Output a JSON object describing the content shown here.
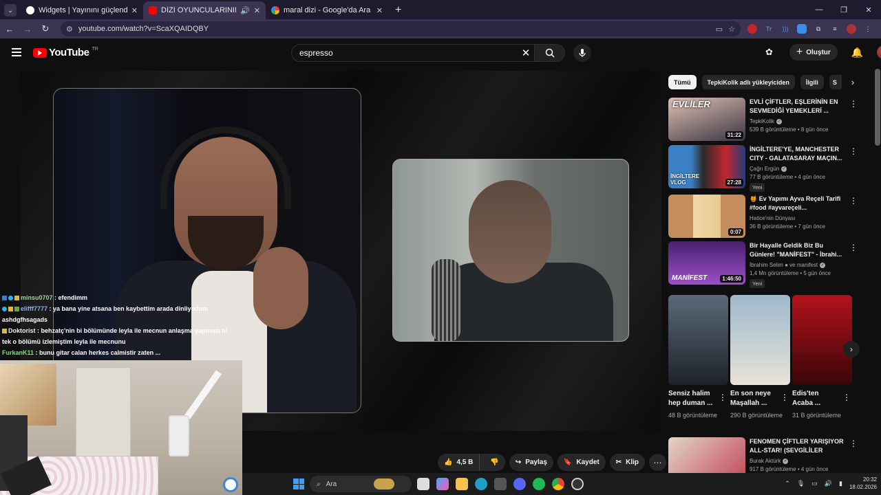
{
  "browser": {
    "tabs": [
      {
        "title": "Widgets | Yayınını güçlendirme",
        "favicon_color": "#ffffff",
        "active": false
      },
      {
        "title": "DİZİ OYUNCULARININ SÖYL",
        "favicon_color": "#ff0000",
        "active": true
      },
      {
        "title": "maral dizi - Google'da Ara",
        "favicon_color": "#ffffff",
        "active": false
      }
    ],
    "url": "youtube.com/watch?v=ScaXQAIDQBY"
  },
  "yt": {
    "logo": "YouTube",
    "region": "TR",
    "search_query": "espresso",
    "create_label": "Oluştur"
  },
  "chat": [
    {
      "user": "minsu0707",
      "text": ": efendimm",
      "color": "#9dd79a"
    },
    {
      "user": "elifff7777",
      "text": ": ya bana yine atsana ben kaybettim arada dinliyodum",
      "color": "#8ab4f8"
    },
    {
      "user": "",
      "text": "ashdgfhsagads",
      "color": "#ffffff"
    },
    {
      "user": "Doktorist",
      "text": ": behzatç'nin bi bölümünde leyla ile mecnun anlaşma yapmıştı bi",
      "color": "#eeeeee"
    },
    {
      "user": "",
      "text": "tek o bölümü izlemiştim leyla ile mecnunu",
      "color": "#ffffff"
    },
    {
      "user": "FurkanK11",
      "text": ": bunu gitar calan herkes calmistir zaten ...",
      "color": "#7ee07a"
    }
  ],
  "actions": {
    "likes": "4,5 B",
    "share": "Paylaş",
    "save": "Kaydet",
    "clip": "Klip"
  },
  "chips": [
    "Tümü",
    "TepkiKolik adlı yükleyiciden",
    "İlgili",
    "S"
  ],
  "recommendations": [
    {
      "title": "EVLİ ÇİFTLER, EŞLERİNİN EN SEVMEDİĞİ YEMEKLERİ ...",
      "channel": "TepkiKolik",
      "verified": true,
      "meta": "539 B görüntüleme • 8 gün önce",
      "duration": "31:22",
      "badge": "",
      "thumb_text": "EVLİLER",
      "color_a": "#d9b7a6",
      "color_b": "#3a3340"
    },
    {
      "title": "İNGİLTERE'YE, MANCHESTER CITY - GALATASARAY MAÇIN...",
      "channel": "Çağrı Ergün",
      "verified": true,
      "meta": "77 B görüntüleme • 4 gün önce",
      "duration": "27:28",
      "badge": "Yeni",
      "thumb_text": "İNGİLTERE VLOG",
      "color_a": "#3b7fc4",
      "color_b": "#c1272d"
    },
    {
      "title": "🍯 Ev Yapımı Ayva Reçeli Tarifi #food #ayvareçeli...",
      "channel": "Hatice'nin Dünyası",
      "verified": false,
      "meta": "36 B görüntüleme • 7 gün önce",
      "duration": "0:07",
      "badge": "",
      "thumb_text": "",
      "color_a": "#c99a6b",
      "color_b": "#e9c48c"
    },
    {
      "title": "Bir Hayalle Geldik Biz Bu Günlere! \"MANİFEST\" - İbrahi...",
      "channel": "İbrahim Selim ● ve manifest",
      "verified": true,
      "meta": "1,4 Mn görüntüleme • 5 gün önce",
      "duration": "1:46:50",
      "badge": "Yeni",
      "thumb_text": "MANİFEST",
      "color_a": "#5a2a8a",
      "color_b": "#b05ad8"
    }
  ],
  "shorts": [
    {
      "title": "Sensiz halim hep duman ...",
      "meta": "48 B görüntüleme",
      "color_a": "#5a6a7a",
      "color_b": "#1d2228"
    },
    {
      "title": "En son neye Maşallah ...",
      "meta": "290 B görüntüleme",
      "color_a": "#c7b8a3",
      "color_b": "#e9e2d7"
    },
    {
      "title": "Edis'ten Acaba ...",
      "meta": "31 B görüntüleme",
      "color_a": "#b3121b",
      "color_b": "#3a0508"
    }
  ],
  "last_rec": {
    "title": "FENOMEN ÇİFTLER YARIŞIYOR ALL-STAR! (SEVGİLİLER GÜNÜ...",
    "channel": "Burak Aktürk",
    "verified": true,
    "meta": "917 B görüntüleme • 4 gün önce"
  },
  "taskbar": {
    "search_placeholder": "Ara",
    "time": "20:32",
    "date": "18.02.2026"
  }
}
